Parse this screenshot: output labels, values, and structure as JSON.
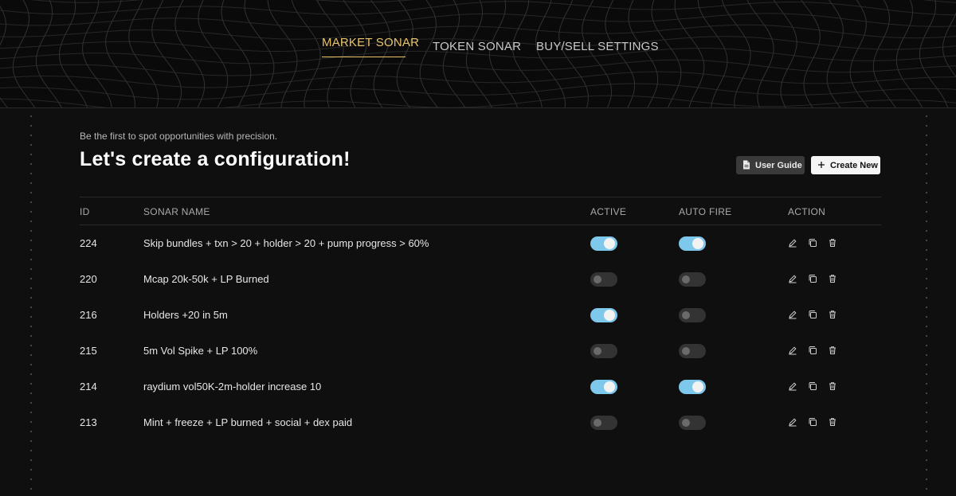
{
  "nav": {
    "items": [
      {
        "label": "MARKET SONAR",
        "active": true
      },
      {
        "label": "TOKEN SONAR",
        "active": false
      },
      {
        "label": "BUY/SELL SETTINGS",
        "active": false
      }
    ]
  },
  "hero": {
    "subtitle": "Be the first to spot opportunities with precision.",
    "title": "Let's create a configuration!"
  },
  "buttons": {
    "user_guide": {
      "label": "User Guide",
      "icon": "document-icon"
    },
    "create_new": {
      "label": "Create New",
      "icon": "plus-icon"
    }
  },
  "table": {
    "headers": {
      "id": "ID",
      "name": "SONAR NAME",
      "active": "ACTIVE",
      "auto_fire": "AUTO FIRE",
      "action": "ACTION"
    },
    "rows": [
      {
        "id": "224",
        "name": "Skip bundles + txn > 20 + holder > 20 + pump progress > 60%",
        "active": true,
        "auto_fire": true
      },
      {
        "id": "220",
        "name": "Mcap 20k-50k + LP Burned",
        "active": false,
        "auto_fire": false
      },
      {
        "id": "216",
        "name": "Holders +20 in 5m",
        "active": true,
        "auto_fire": false
      },
      {
        "id": "215",
        "name": "5m Vol Spike + LP 100%",
        "active": false,
        "auto_fire": false
      },
      {
        "id": "214",
        "name": "raydium vol50K-2m-holder increase 10",
        "active": true,
        "auto_fire": true
      },
      {
        "id": "213",
        "name": "Mint + freeze + LP burned + social + dex paid",
        "active": false,
        "auto_fire": false
      }
    ],
    "actions": [
      "edit-icon",
      "copy-icon",
      "trash-icon"
    ]
  },
  "colors": {
    "accent": "#e9c46a",
    "toggle_on": "#7ec8ec",
    "background": "#0f0f0f"
  }
}
